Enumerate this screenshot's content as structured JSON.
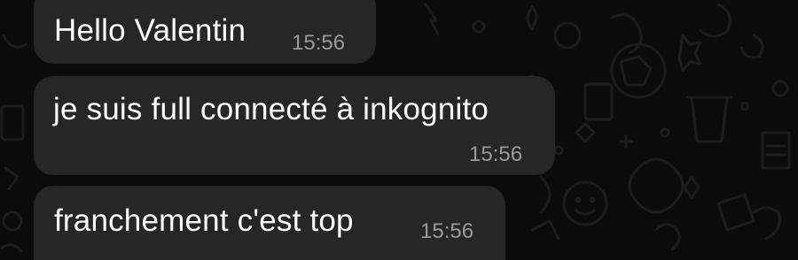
{
  "chat": {
    "wallpaper": "dark doodle pattern",
    "messages": [
      {
        "text": "Hello Valentin",
        "time": "15:56"
      },
      {
        "text": "je suis full connecté à inkognito",
        "time": "15:56"
      },
      {
        "text": "franchement c'est top",
        "time": "15:56"
      }
    ]
  },
  "colors": {
    "background": "#0b0b0b",
    "bubble": "#262626",
    "text": "#ffffff",
    "timestamp": "#9a9a9a"
  }
}
